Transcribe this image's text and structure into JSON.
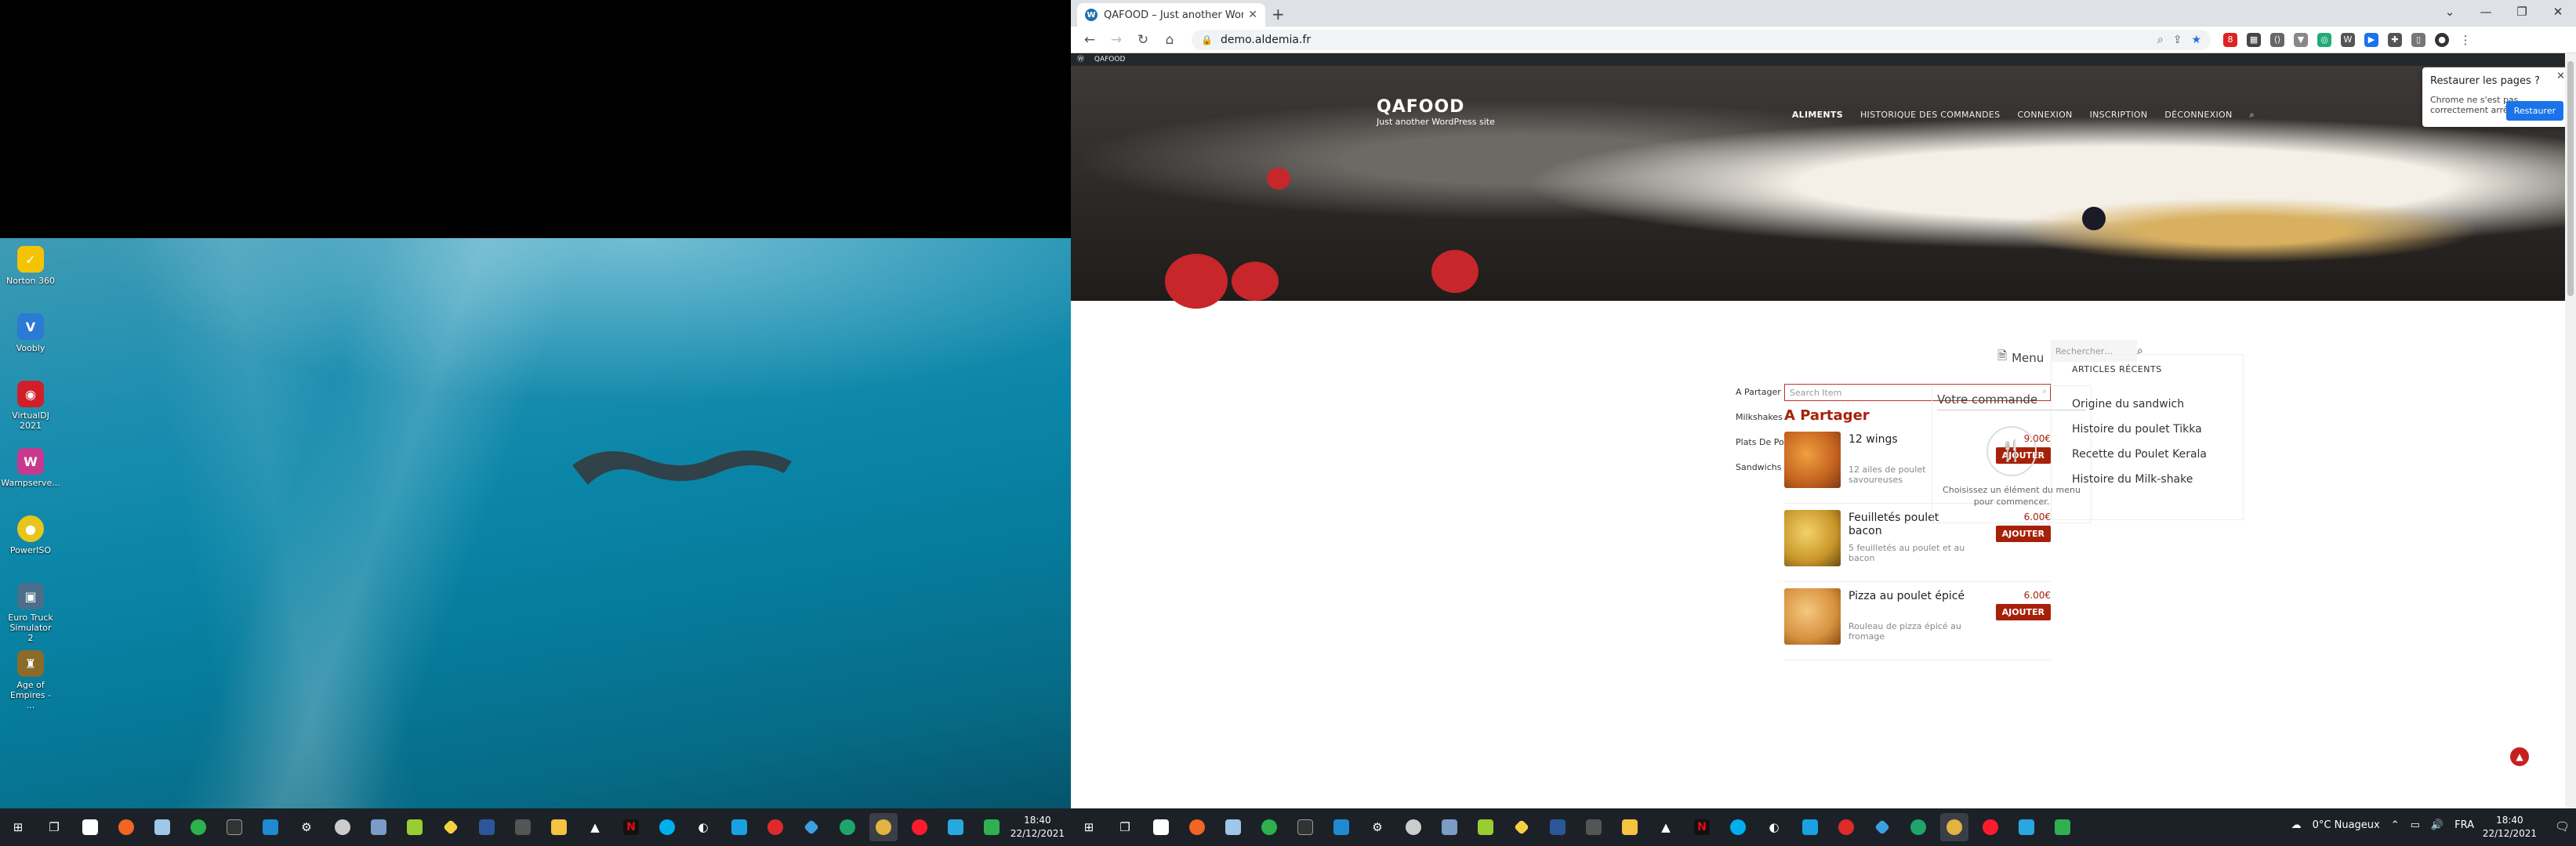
{
  "desktop": {
    "icons": [
      {
        "label": "Norton 360",
        "icon": "norton-icon",
        "color": "#f5c400"
      },
      {
        "label": "Voobly",
        "icon": "voobly-icon",
        "color": "#2a7ad6"
      },
      {
        "label": "VirtualDJ 2021",
        "icon": "virtualdj-icon",
        "color": "#d11f2a"
      },
      {
        "label": "Wampserve...",
        "icon": "wampserver-icon",
        "color": "#c8398d"
      },
      {
        "label": "PowerISO",
        "icon": "poweriso-icon",
        "color": "#e8c51a"
      },
      {
        "label": "Euro Truck Simulator 2",
        "icon": "euro-truck-icon",
        "color": "#4b6e8a"
      },
      {
        "label": "Age of Empires - ...",
        "icon": "age-of-empires-icon",
        "color": "#8a6b2a"
      }
    ]
  },
  "taskbar_left": {
    "clock_time": "18:40",
    "clock_date": "22/12/2021"
  },
  "taskbar_right": {
    "weather": "0°C  Nuageux",
    "lang": "FRA",
    "clock_time": "18:40",
    "clock_date": "22/12/2021"
  },
  "browser": {
    "tab_title": "QAFOOD – Just another WordPress site",
    "tab_favicon": "W",
    "url": "demo.aldemia.fr",
    "admin_bar": "QAFOOD",
    "restore_popup": {
      "title": "Restaurer les pages ?",
      "subtitle": "Chrome ne s'est pas correctement arrêté.",
      "button": "Restaurer"
    }
  },
  "site": {
    "name": "QAFOOD",
    "description": "Just another WordPress site",
    "nav": [
      "ALIMENTS",
      "HISTORIQUE DES COMMANDES",
      "CONNEXION",
      "INSCRIPTION",
      "DÉCONNEXION"
    ],
    "menu_label": "Menu",
    "search_placeholder": "Rechercher…",
    "categories": [
      "A Partager",
      "Milkshakes",
      "Plats De Poulets",
      "Sandwichs"
    ],
    "item_search_placeholder": "Search Item",
    "section_title": "A Partager",
    "items": [
      {
        "name": "12 wings",
        "desc": "12 ailes de poulet savoureuses",
        "price": "9.00€",
        "button": "AJOUTER"
      },
      {
        "name": "Feuilletés poulet bacon",
        "desc": "5 feuilletés au poulet et au bacon",
        "price": "6.00€",
        "button": "AJOUTER"
      },
      {
        "name": "Pizza au poulet épicé",
        "desc": "Rouleau de pizza épicé au fromage",
        "price": "6.00€",
        "button": "AJOUTER"
      }
    ],
    "order": {
      "title": "Votre commande",
      "empty_text": "Choisissez un élément du menu pour commencer."
    },
    "articles": {
      "title": "ARTICLES RÉCENTS",
      "links": [
        "Origine du sandwich",
        "Histoire du poulet Tikka",
        "Recette du Poulet Kerala",
        "Histoire du Milk-shake"
      ]
    }
  }
}
